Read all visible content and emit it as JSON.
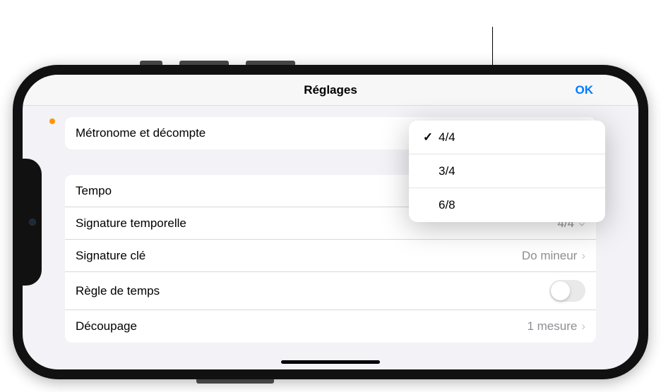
{
  "nav": {
    "title": "Réglages",
    "ok": "OK"
  },
  "section1": {
    "metronome": {
      "label": "Métronome et décompte"
    }
  },
  "section2": {
    "tempo": {
      "label": "Tempo"
    },
    "timeSignature": {
      "label": "Signature temporelle",
      "value": "4/4"
    },
    "keySignature": {
      "label": "Signature clé",
      "value": "Do mineur"
    },
    "timeRuler": {
      "label": "Règle de temps"
    },
    "snap": {
      "label": "Découpage",
      "value": "1 mesure"
    }
  },
  "popover": {
    "options": [
      "4/4",
      "3/4",
      "6/8"
    ],
    "selectedIndex": 0
  },
  "icons": {
    "check": "✓",
    "chevron": "›",
    "popupCaret": "⌃⌄"
  }
}
